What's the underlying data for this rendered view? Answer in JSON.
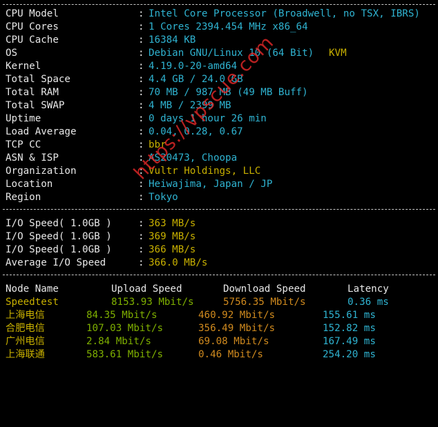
{
  "sysinfo": [
    {
      "key": "CPU Model",
      "value": "Intel Core Processor (Broadwell, no TSX, IBRS)",
      "color": "cyan"
    },
    {
      "key": "CPU Cores",
      "value": "1 Cores 2394.454 MHz x86_64",
      "color": "cyan"
    },
    {
      "key": "CPU Cache",
      "value": "16384 KB",
      "color": "cyan"
    },
    {
      "key": "OS",
      "value": "Debian GNU/Linux 10 (64 Bit)",
      "extra": "KVM",
      "color": "cyan"
    },
    {
      "key": "Kernel",
      "value": "4.19.0-20-amd64",
      "color": "cyan"
    },
    {
      "key": "Total Space",
      "value": "4.4 GB / 24.0 GB",
      "color": "cyan"
    },
    {
      "key": "Total RAM",
      "value": "70 MB / 987 MB (49 MB Buff)",
      "color": "cyan"
    },
    {
      "key": "Total SWAP",
      "value": "4 MB / 2399 MB",
      "color": "cyan"
    },
    {
      "key": "Uptime",
      "value": "0 days 1 hour 26 min",
      "color": "cyan"
    },
    {
      "key": "Load Average",
      "value": "0.04, 0.28, 0.67",
      "color": "cyan"
    },
    {
      "key": "TCP CC",
      "value": "bbr",
      "color": "yellow"
    },
    {
      "key": "ASN & ISP",
      "value": "AS20473, Choopa",
      "color": "cyan"
    },
    {
      "key": "Organization",
      "value": "Vultr Holdings, LLC",
      "color": "yellow"
    },
    {
      "key": "Location",
      "value": "Heiwajima, Japan / JP",
      "color": "cyan"
    },
    {
      "key": "Region",
      "value": "Tokyo",
      "color": "cyan"
    }
  ],
  "colon": ":",
  "io": [
    {
      "key": "I/O Speed( 1.0GB )",
      "value": "363 MB/s"
    },
    {
      "key": "I/O Speed( 1.0GB )",
      "value": "369 MB/s"
    },
    {
      "key": "I/O Speed( 1.0GB )",
      "value": "366 MB/s"
    },
    {
      "key": "Average I/O Speed",
      "value": "366.0 MB/s"
    }
  ],
  "speed_header": {
    "node": "Node Name",
    "upload": "Upload Speed",
    "download": "Download Speed",
    "latency": "Latency"
  },
  "speed_rows": [
    {
      "node": "Speedtest",
      "upload": "8153.93 Mbit/s",
      "download": "5756.35 Mbit/s",
      "latency": "0.36 ms"
    },
    {
      "node": "上海电信",
      "upload": "84.35 Mbit/s",
      "download": "460.92 Mbit/s",
      "latency": "155.61 ms"
    },
    {
      "node": "合肥电信",
      "upload": "107.03 Mbit/s",
      "download": "356.49 Mbit/s",
      "latency": "152.82 ms"
    },
    {
      "node": "广州电信",
      "upload": "2.84 Mbit/s",
      "download": "69.08 Mbit/s",
      "latency": "167.49 ms"
    },
    {
      "node": "上海联通",
      "upload": "583.61 Mbit/s",
      "download": "0.46 Mbit/s",
      "latency": "254.20 ms"
    }
  ],
  "watermark": "https://vpscue.com",
  "colors": {
    "cyan": "#2fb3d1",
    "yellow": "#c8b000",
    "green": "#7fb000",
    "orange": "#d08a1e",
    "background": "#000000"
  }
}
